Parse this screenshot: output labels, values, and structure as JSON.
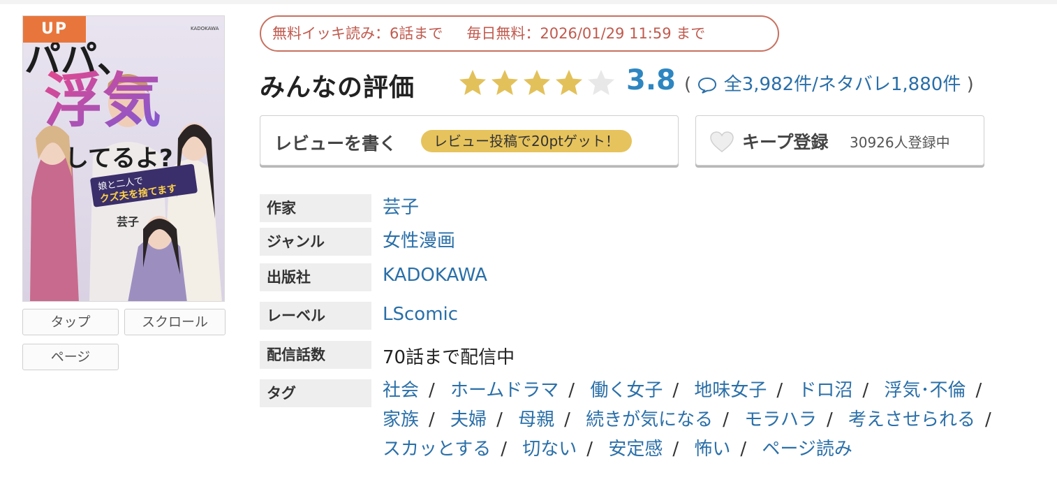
{
  "cover": {
    "badge": "UP",
    "publisher_mark": "KADOKAWA",
    "title_art_1": "パパ、",
    "title_art_2": "浮気",
    "title_art_3": "してるよ?",
    "subtitle_art": "娘と二人で",
    "subtitle_art_2": "クズ夫を捨てます",
    "author_art": "芸子"
  },
  "view_modes": [
    "タップ",
    "スクロール",
    "ページ"
  ],
  "free_banner": {
    "free_read": "無料イッキ読み：6話まで",
    "daily_free": "毎日無料：2026/01/29 11:59 まで"
  },
  "rating": {
    "title": "みんなの評価",
    "score_value": 3.8,
    "score_text": "3.8",
    "paren_open": "(",
    "paren_close": ")",
    "counts": "全3,982件/ネタバレ1,880件",
    "star_color": "#e3c15a",
    "empty_star_color": "#e8e8e8"
  },
  "actions": {
    "write_review": "レビューを書く",
    "write_review_promo": "レビュー投稿で20ptゲット！",
    "keep": "キープ登録",
    "keep_count": "30926人登録中"
  },
  "info": {
    "author_label": "作家",
    "author": "芸子",
    "genre_label": "ジャンル",
    "genre": "女性漫画",
    "publisher_label": "出版社",
    "publisher": "KADOKAWA",
    "label_label": "レーベル",
    "label": "LScomic",
    "episodes_label": "配信話数",
    "episodes": "70話まで配信中",
    "tags_label": "タグ"
  },
  "tags": [
    "社会",
    "ホームドラマ",
    "働く女子",
    "地味女子",
    "ドロ沼",
    "浮気･不倫",
    "家族",
    "夫婦",
    "母親",
    "続きが気になる",
    "モラハラ",
    "考えさせられる",
    "スカッとする",
    "切ない",
    "安定感",
    "怖い",
    "ページ読み"
  ],
  "colors": {
    "link": "#2a6fa8",
    "badge": "#e8763c",
    "banner": "#c05a4e",
    "score": "#2e86c1",
    "promo_pill": "#e6c35c"
  }
}
